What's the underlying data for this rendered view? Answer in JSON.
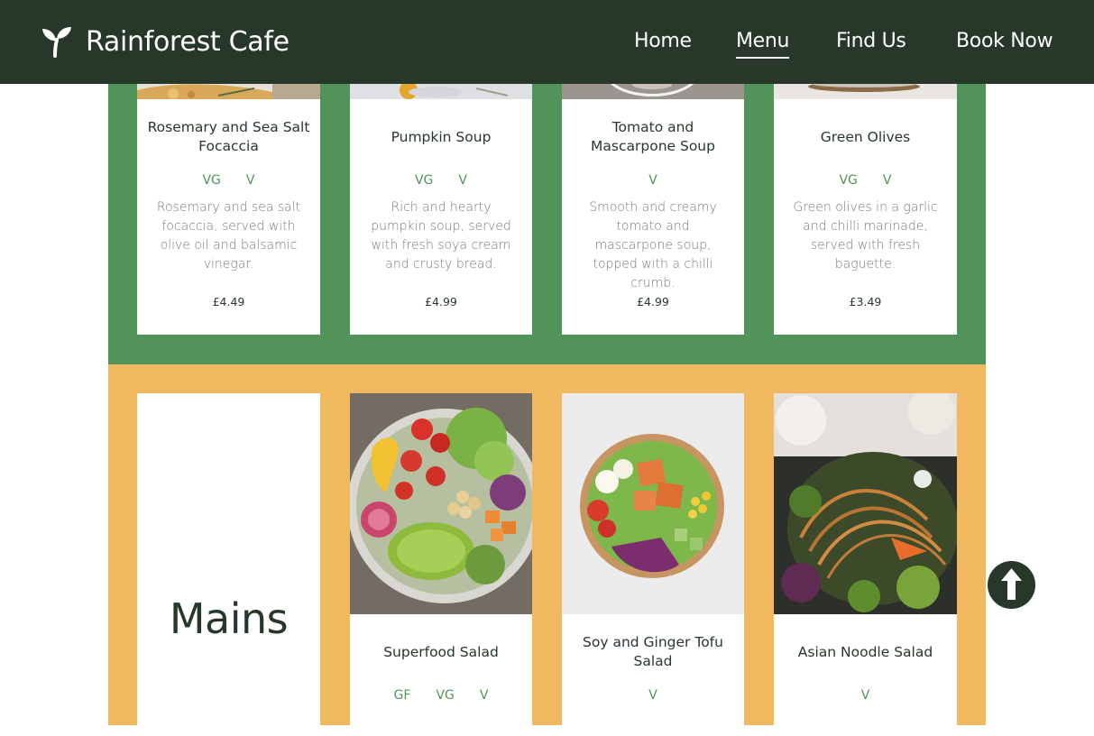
{
  "header": {
    "brand": "Rainforest Cafe",
    "nav": {
      "home": "Home",
      "menu": "Menu",
      "find_us": "Find Us",
      "book_now": "Book Now"
    },
    "active": "Menu"
  },
  "starters": [
    {
      "title": "Rosemary and Sea Salt Focaccia",
      "tags": [
        "VG",
        "V"
      ],
      "description": "Rosemary and sea salt focaccia, served with olive oil and balsamic vinegar.",
      "price": "£4.49"
    },
    {
      "title": "Pumpkin Soup",
      "tags": [
        "VG",
        "V"
      ],
      "description": "Rich and hearty pumpkin soup, served with fresh soya cream and crusty bread.",
      "price": "£4.99"
    },
    {
      "title": "Tomato and Mascarpone Soup",
      "tags": [
        "V"
      ],
      "description": "Smooth and creamy tomato and mascarpone soup, topped with a chilli crumb.",
      "price": "£4.99"
    },
    {
      "title": "Green Olives",
      "tags": [
        "VG",
        "V"
      ],
      "description": "Green olives in a garlic and chilli marinade, served with fresh baguette.",
      "price": "£3.49"
    }
  ],
  "mains": {
    "heading": "Mains",
    "items": [
      {
        "title": "Superfood Salad",
        "tags": [
          "GF",
          "VG",
          "V"
        ]
      },
      {
        "title": "Soy and Ginger Tofu Salad",
        "tags": [
          "V"
        ]
      },
      {
        "title": "Asian Noodle Salad",
        "tags": [
          "V"
        ]
      }
    ]
  },
  "colors": {
    "header_bg": "#27382a",
    "starters_bg": "#52935a",
    "mains_bg": "#f0b95f",
    "tag": "#52935a"
  },
  "icons": {
    "logo": "sprout-icon",
    "back_to_top": "arrow-up-icon"
  }
}
